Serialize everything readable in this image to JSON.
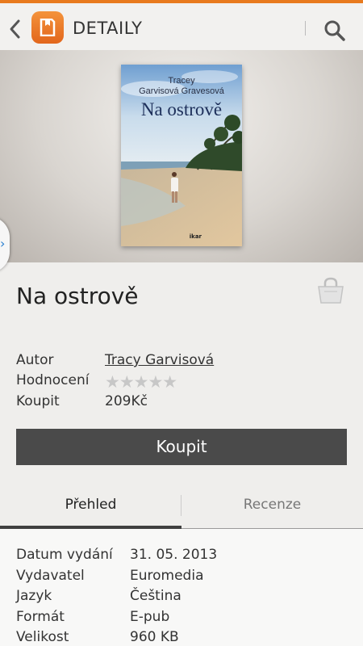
{
  "header": {
    "title": "DETAILY"
  },
  "book": {
    "cover_author": "Tracey Garvisová Gravesová",
    "cover_author_line1": "Tracey",
    "cover_author_line2": "Garvisová Gravesová",
    "cover_title": "Na ostrově",
    "cover_publisher": "ikar",
    "title": "Na ostrově"
  },
  "info": {
    "author_label": "Autor",
    "author_value": "Tracy Garvisová",
    "rating_label": "Hodnocení",
    "rating_stars": "★★★★★",
    "rating_value": 0,
    "buy_label": "Koupit",
    "price": "209Kč"
  },
  "buy_button": "Koupit",
  "tabs": [
    {
      "label": "Přehled",
      "active": true
    },
    {
      "label": "Recenze",
      "active": false
    }
  ],
  "details": [
    {
      "label": "Datum vydání",
      "value": "31. 05. 2013"
    },
    {
      "label": "Vydavatel",
      "value": "Euromedia"
    },
    {
      "label": "Jazyk",
      "value": "Čeština"
    },
    {
      "label": "Formát",
      "value": "E-pub"
    },
    {
      "label": "Velikost",
      "value": "960 KB"
    }
  ],
  "colors": {
    "accent": "#e87a1e",
    "button": "#4a4a4a",
    "link_arrow": "#2a7fd0"
  },
  "icons": {
    "back": "chevron-left-icon",
    "app": "book-app-icon",
    "search": "search-icon",
    "cart": "shopping-bag-icon",
    "drawer": "chevron-right-icon"
  }
}
